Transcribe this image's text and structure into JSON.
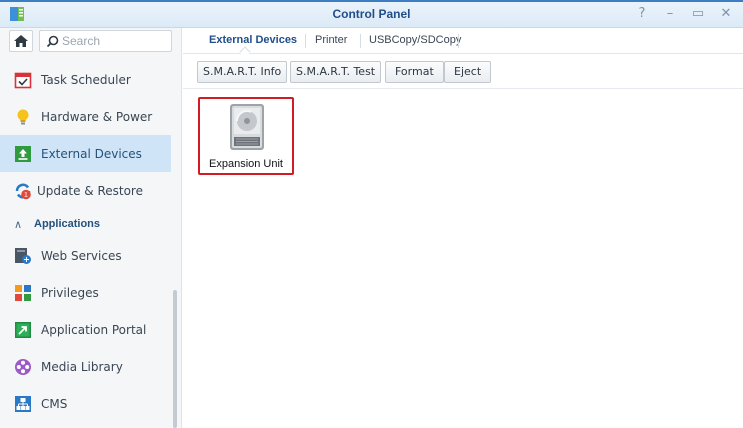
{
  "window": {
    "title": "Control Panel",
    "controls": [
      "help-icon",
      "minimize-icon",
      "maximize-icon",
      "close-icon"
    ]
  },
  "search": {
    "placeholder": "Search"
  },
  "sidebar": {
    "items": [
      {
        "label": "Task Scheduler",
        "icon": "calendar-check-icon"
      },
      {
        "label": "Hardware & Power",
        "icon": "lightbulb-icon"
      },
      {
        "label": "External Devices",
        "icon": "upload-box-icon",
        "active": true
      },
      {
        "label": "Update & Restore",
        "icon": "refresh-badge-icon",
        "badge": "1"
      }
    ],
    "section": {
      "label": "Applications"
    },
    "apps": [
      {
        "label": "Web Services",
        "icon": "web-services-icon"
      },
      {
        "label": "Privileges",
        "icon": "privileges-icon"
      },
      {
        "label": "Application Portal",
        "icon": "portal-arrow-icon"
      },
      {
        "label": "Media Library",
        "icon": "film-reel-icon"
      },
      {
        "label": "CMS",
        "icon": "cms-network-icon"
      }
    ]
  },
  "tabs": [
    {
      "label": "External Devices",
      "active": true
    },
    {
      "label": "Printer"
    },
    {
      "label": "USBCopy/SDCopy"
    }
  ],
  "toolbar": {
    "smart_info": "S.M.A.R.T. Info",
    "smart_test": "S.M.A.R.T. Test",
    "format": "Format",
    "eject": "Eject"
  },
  "devices": [
    {
      "label": "Expansion Unit",
      "icon": "hard-drive-icon",
      "selected": true
    }
  ],
  "colors": {
    "accent": "#3d7ec2",
    "active_bg": "#cfe4f7",
    "selection": "#d21c24",
    "badge": "#e2483b"
  }
}
